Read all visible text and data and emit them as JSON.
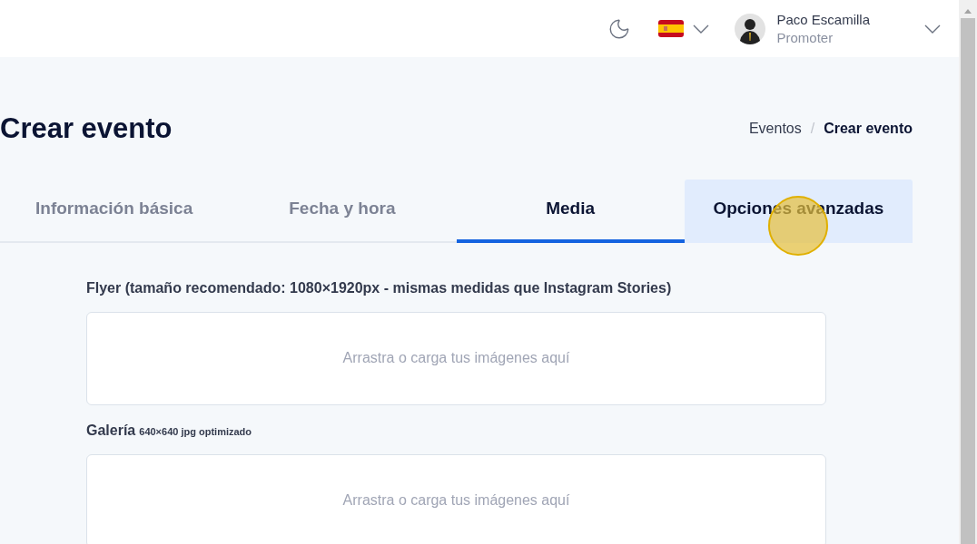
{
  "header": {
    "user": {
      "name": "Paco Escamilla",
      "role": "Promoter"
    }
  },
  "page": {
    "title": "Crear evento",
    "breadcrumb_separator": "/",
    "breadcrumb": [
      {
        "label": "Eventos",
        "current": false
      },
      {
        "label": "Crear evento",
        "current": true
      }
    ]
  },
  "tabs": [
    {
      "label": "Información básica",
      "selected": false,
      "hovered": false
    },
    {
      "label": "Fecha y hora",
      "selected": false,
      "hovered": false
    },
    {
      "label": "Media",
      "selected": true,
      "hovered": false
    },
    {
      "label": "Opciones avanzadas",
      "selected": false,
      "hovered": true
    }
  ],
  "uploads": [
    {
      "label": "Flyer (tamaño recomendado: 1080×1920px - mismas medidas que Instagram Stories)",
      "placeholder": "Arrastra o carga tus imágenes aquí"
    },
    {
      "label": "Galería",
      "hint": "640×640 jpg optimizado",
      "placeholder": "Arrastra o carga tus imágenes aquí"
    }
  ]
}
